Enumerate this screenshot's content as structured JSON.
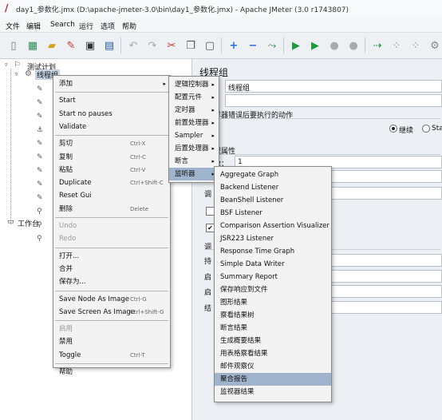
{
  "window": {
    "title": "day1_参数化.jmx (D:\\apache-jmeter-3.0\\bin\\day1_参数化.jmx) - Apache JMeter (3.0 r1743807)"
  },
  "menubar": {
    "items": [
      "文件",
      "编辑",
      "Search",
      "运行",
      "选项",
      "帮助"
    ]
  },
  "tree": {
    "root": "测试计划",
    "thread_group": "线程组",
    "workbench": "工作台"
  },
  "right_panel": {
    "heading": "线程组",
    "name_value": "线程组",
    "error_action_label": "样器错误后要执行的动作",
    "radio_continue": "继续",
    "radio_start": "Sta",
    "thread_props_label": "程属性",
    "threads_value": "1",
    "name_prefix": "：",
    "threads_prefix": "数：",
    "misc_labels": [
      "调",
      "持",
      "启",
      "启",
      "结"
    ],
    "sched_label": "调"
  },
  "context_menu": {
    "items": [
      {
        "label": "添加",
        "submenu": true
      },
      {
        "sep": true
      },
      {
        "label": "Start"
      },
      {
        "label": "Start no pauses"
      },
      {
        "label": "Validate"
      },
      {
        "sep": true
      },
      {
        "label": "剪切",
        "shortcut": "Ctrl-X"
      },
      {
        "label": "复制",
        "shortcut": "Ctrl-C"
      },
      {
        "label": "粘贴",
        "shortcut": "Ctrl-V"
      },
      {
        "label": "Duplicate",
        "shortcut": "Ctrl+Shift-C"
      },
      {
        "label": "Reset Gui"
      },
      {
        "label": "删除",
        "shortcut": "Delete"
      },
      {
        "sep": true
      },
      {
        "label": "Undo",
        "disabled": true
      },
      {
        "label": "Redo",
        "disabled": true
      },
      {
        "sep": true
      },
      {
        "label": "打开..."
      },
      {
        "label": "合并"
      },
      {
        "label": "保存为..."
      },
      {
        "sep": true
      },
      {
        "label": "Save Node As Image",
        "shortcut": "Ctrl-G"
      },
      {
        "label": "Save Screen As Image",
        "shortcut": "Ctrl+Shift-G"
      },
      {
        "sep": true
      },
      {
        "label": "启用",
        "disabled": true
      },
      {
        "label": "禁用"
      },
      {
        "label": "Toggle",
        "shortcut": "Ctrl-T"
      },
      {
        "sep": true
      },
      {
        "label": "帮助"
      }
    ]
  },
  "add_submenu": {
    "items": [
      {
        "label": "逻辑控制器"
      },
      {
        "label": "配置元件"
      },
      {
        "label": "定时器"
      },
      {
        "label": "前置处理器"
      },
      {
        "label": "Sampler"
      },
      {
        "label": "后置处理器"
      },
      {
        "label": "断言"
      },
      {
        "label": "监听器",
        "highlighted": true
      }
    ]
  },
  "listener_submenu": {
    "items": [
      {
        "label": "Aggregate Graph"
      },
      {
        "label": "Backend Listener"
      },
      {
        "label": "BeanShell Listener"
      },
      {
        "label": "BSF Listener"
      },
      {
        "label": "Comparison Assertion Visualizer"
      },
      {
        "label": "JSR223 Listener"
      },
      {
        "label": "Response Time Graph"
      },
      {
        "label": "Simple Data Writer"
      },
      {
        "label": "Summary Report"
      },
      {
        "label": "保存响应到文件"
      },
      {
        "label": "图形结果"
      },
      {
        "label": "察看结果树"
      },
      {
        "label": "断言结果"
      },
      {
        "label": "生成概要结果"
      },
      {
        "label": "用表格察看结果"
      },
      {
        "label": "邮件观察仪"
      },
      {
        "label": "聚合报告",
        "highlighted": true
      },
      {
        "label": "监视器结果"
      }
    ]
  }
}
